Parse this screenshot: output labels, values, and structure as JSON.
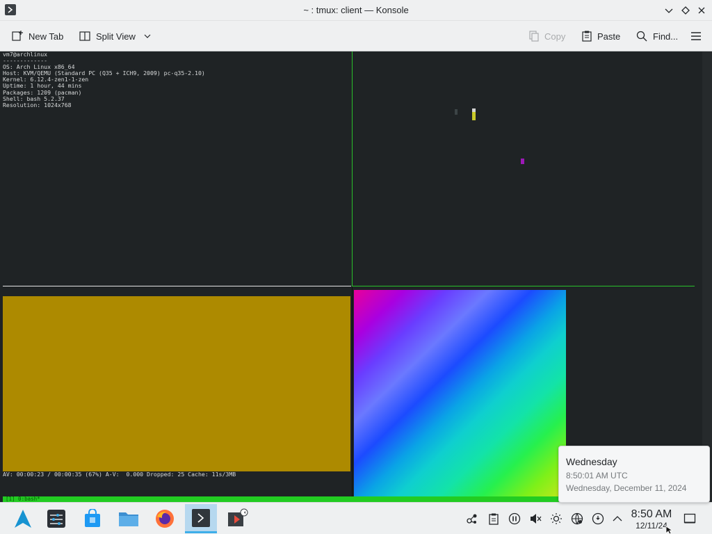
{
  "window": {
    "title": "~ : tmux: client — Konsole"
  },
  "toolbar": {
    "new_tab": "New Tab",
    "split_view": "Split View",
    "copy": "Copy",
    "paste": "Paste",
    "find": "Find..."
  },
  "terminal": {
    "neofetch_lines": [
      "vm7@archlinux",
      "-------------",
      "OS: Arch Linux x86_64",
      "Host: KVM/QEMU (Standard PC (Q35 + ICH9, 2009) pc-q35-2.10)",
      "Kernel: 6.12.4-zen1-1-zen",
      "Uptime: 1 hour, 44 mins",
      "Packages: 1209 (pacman)",
      "Shell: bash 5.2.37",
      "Resolution: 1024x768"
    ],
    "mpv_status": "AV: 00:00:23 / 00:00:35 (67%) A-V:  0.000 Dropped: 25 Cache: 11s/3MB",
    "tmux_status": "[1] 0:bash*",
    "colors": {
      "background": "#1f2325",
      "pane_border_active": "#29c12b",
      "mpv_fill": "#ad8a00",
      "status_bar": "#22cc22"
    }
  },
  "taskbar": {
    "apps": [
      "arch-launcher-icon",
      "system-settings-icon",
      "discover-icon",
      "file-manager-icon",
      "firefox-icon",
      "konsole-icon",
      "media-player-icon"
    ],
    "clock_time": "8:50 AM",
    "clock_date": "12/11/24"
  },
  "tooltip": {
    "day": "Wednesday",
    "time_utc": "8:50:01 AM UTC",
    "full_date": "Wednesday, December 11, 2024"
  }
}
